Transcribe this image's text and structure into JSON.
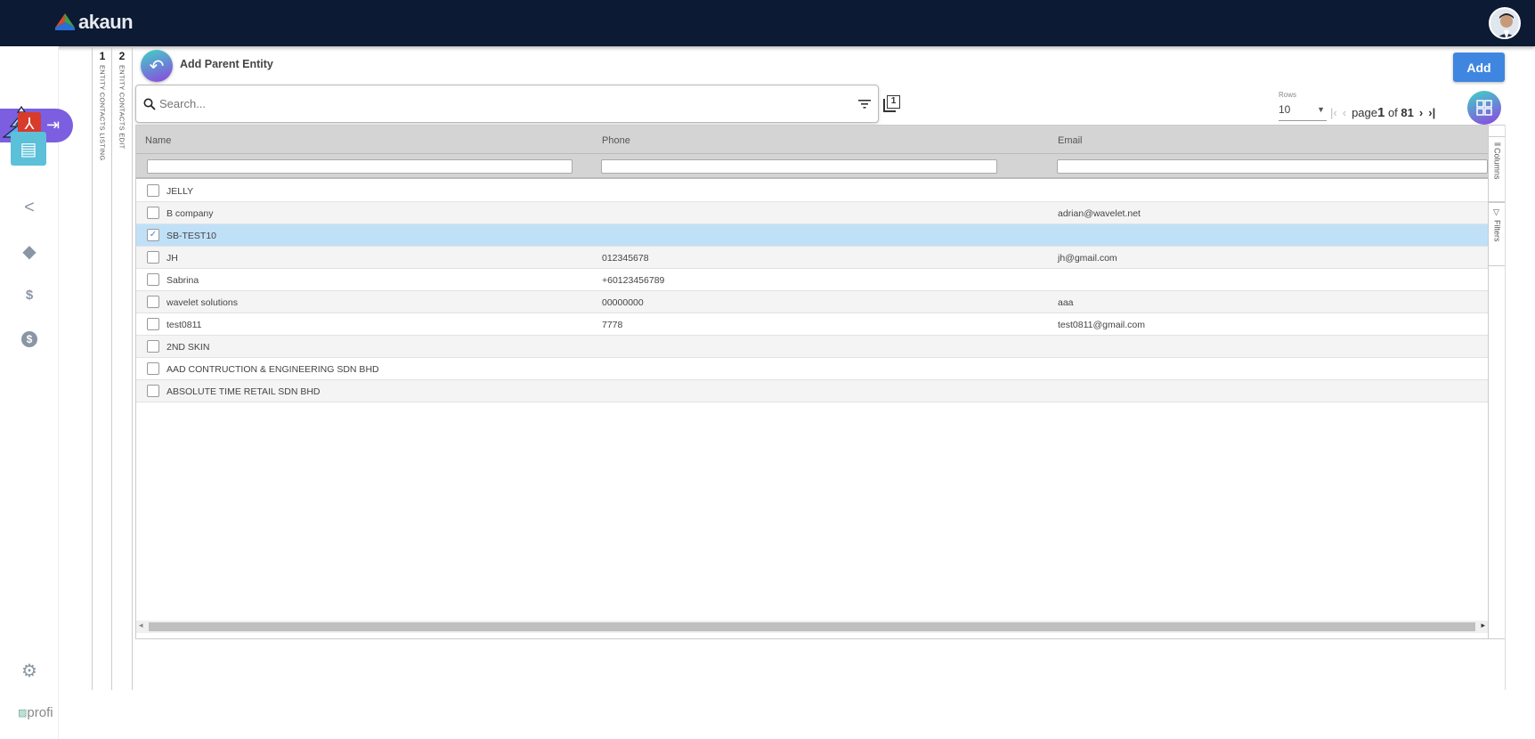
{
  "app": {
    "name": "akaun"
  },
  "rails": [
    {
      "num": "1",
      "label": "ENTITY CONTACTS LISTING"
    },
    {
      "num": "2",
      "label": "ENTITY CONTACTS EDIT"
    }
  ],
  "page": {
    "title": "Add Parent Entity",
    "add_label": "Add"
  },
  "search": {
    "placeholder": "Search..."
  },
  "copy_badge": "1",
  "pager": {
    "rows_label": "Rows",
    "rows_value": "10",
    "page_word": "page",
    "current": "1",
    "of_word": "of",
    "total": "81"
  },
  "grid": {
    "columns": [
      "Name",
      "Phone",
      "Email"
    ],
    "rows": [
      {
        "name": "JELLY",
        "phone": "",
        "email": "",
        "checked": false
      },
      {
        "name": "B company",
        "phone": "",
        "email": "adrian@wavelet.net",
        "checked": false
      },
      {
        "name": "SB-TEST10",
        "phone": "",
        "email": "",
        "checked": true
      },
      {
        "name": "JH",
        "phone": "012345678",
        "email": "jh@gmail.com",
        "checked": false
      },
      {
        "name": "Sabrina",
        "phone": "+60123456789",
        "email": "",
        "checked": false
      },
      {
        "name": "wavelet solutions",
        "phone": "00000000",
        "email": "aaa",
        "checked": false
      },
      {
        "name": "test0811",
        "phone": "7778",
        "email": "test0811@gmail.com",
        "checked": false
      },
      {
        "name": "2ND SKIN",
        "phone": "",
        "email": "",
        "checked": false
      },
      {
        "name": "AAD CONTRUCTION & ENGINEERING SDN BHD",
        "phone": "",
        "email": "",
        "checked": false
      },
      {
        "name": "ABSOLUTE TIME RETAIL SDN BHD",
        "phone": "",
        "email": "",
        "checked": false
      }
    ],
    "side_tabs": [
      "Columns",
      "Filters"
    ]
  },
  "profile_alt": "profi",
  "colors": {
    "topbar": "#0c1a33",
    "accent": "#3f86e0",
    "selected_row": "#c0e0f8",
    "pill": "#7b5fe0"
  }
}
